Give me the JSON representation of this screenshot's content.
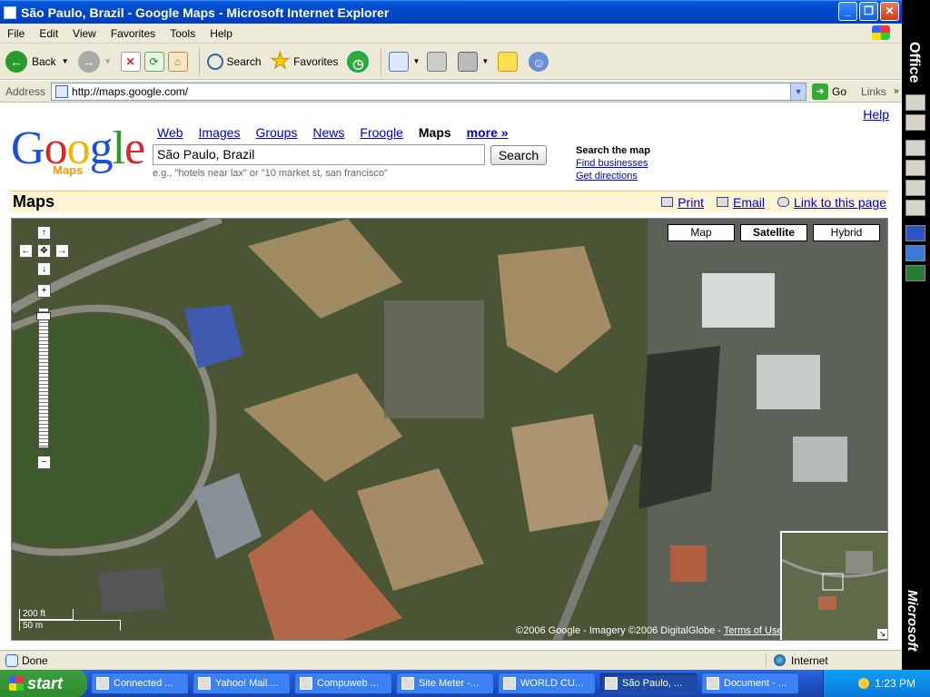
{
  "window": {
    "title": "São Paulo, Brazil - Google Maps - Microsoft Internet Explorer"
  },
  "menu": [
    "File",
    "Edit",
    "View",
    "Favorites",
    "Tools",
    "Help"
  ],
  "toolbar": {
    "back": "Back",
    "search": "Search",
    "favorites": "Favorites"
  },
  "address": {
    "label": "Address",
    "url": "http://maps.google.com/",
    "go": "Go",
    "links": "Links"
  },
  "google": {
    "help": "Help",
    "logo": "Google",
    "logo_sub": "Maps",
    "tabs": {
      "web": "Web",
      "images": "Images",
      "groups": "Groups",
      "news": "News",
      "froogle": "Froogle",
      "maps": "Maps",
      "more": "more »"
    },
    "search_value": "São Paulo, Brazil",
    "search_button": "Search",
    "hint": "e.g., \"hotels near lax\" or \"10 market st, san francisco\"",
    "side": {
      "title": "Search the map",
      "find": "Find businesses",
      "directions": "Get directions"
    },
    "maps_title": "Maps",
    "actions": {
      "print": "Print",
      "email": "Email",
      "link": "Link to this page"
    }
  },
  "map": {
    "types": {
      "map": "Map",
      "satellite": "Satellite",
      "hybrid": "Hybrid"
    },
    "selected_type": "Satellite",
    "copyright": "©2006 Google - Imagery ©2006 DigitalGlobe - ",
    "terms": "Terms of Use",
    "scale_ft": "200 ft",
    "scale_m": "50 m",
    "watermark": "© 2006 Google"
  },
  "status": {
    "text": "Done",
    "zone": "Internet"
  },
  "taskbar": {
    "start": "start",
    "tasks": [
      "Connected ...",
      "Yahoo! Mail....",
      "Compuweb ...",
      "Site Meter -...",
      "WORLD CU...",
      "São Paulo, ...",
      "Document - ..."
    ],
    "active_index": 5,
    "clock": "1:23 PM"
  },
  "officebar": {
    "top": "Office",
    "bottom": "Microsoft"
  }
}
